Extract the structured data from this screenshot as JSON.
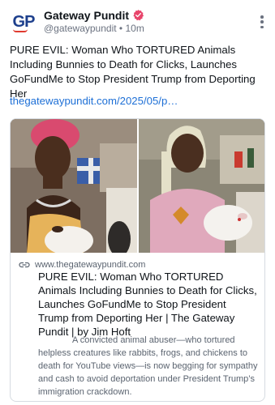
{
  "post": {
    "author": {
      "display_name": "Gateway Pundit",
      "avatar_text": "GP",
      "handle": "@gatewaypundit",
      "separator": "•",
      "time": "10m",
      "verified_color": "#e8456b"
    },
    "text": "PURE EVIL: Woman Who TORTURED Animals Including Bunnies to Death for Clicks, Launches GoFundMe to Stop President Trump from Deporting Her",
    "link_text": "thegatewaypundit.com/2025/05/p…",
    "link_color": "#1d6fd6"
  },
  "card": {
    "domain": "www.thegatewaypundit.com",
    "title": "PURE EVIL: Woman Who TORTURED Animals Including Bunnies to Death for Clicks, Launches GoFundMe to Stop President Trump from Deporting Her | The Gateway Pundit | by Jim Hoft",
    "description": "A convicted animal abuser—who tortured helpless creatures like rabbits, frogs, and chickens to death for YouTube views—is now begging for sympathy and cash to avoid deportation under President Trump’s immigration crackdown."
  },
  "icons": {
    "verified": "verified-badge-icon",
    "more": "more-vertical-icon",
    "link": "link-icon"
  }
}
